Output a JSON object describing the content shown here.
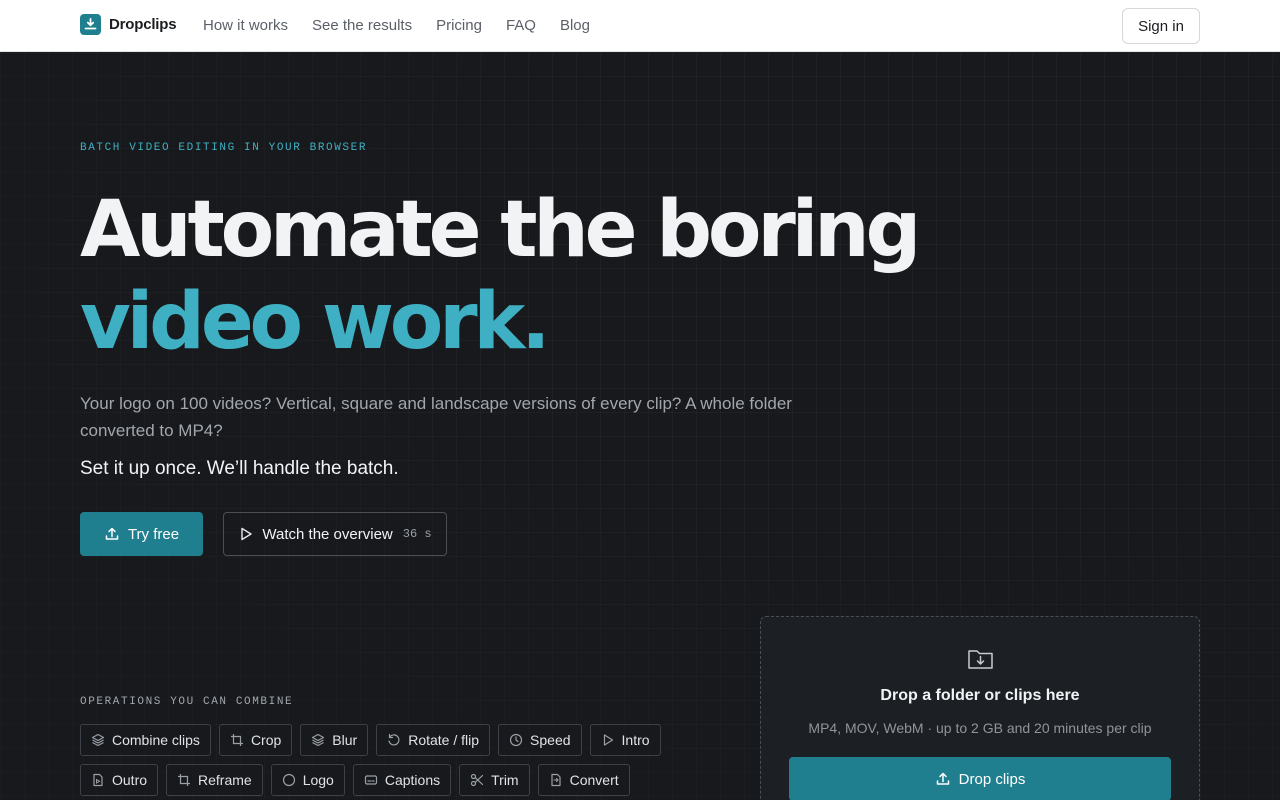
{
  "brand": {
    "name": "Dropclips",
    "accent": "#1f7f8f",
    "icon": "download-tray-icon"
  },
  "nav": {
    "links": [
      "How it works",
      "See the results",
      "Pricing",
      "FAQ",
      "Blog"
    ],
    "signin_label": "Sign in"
  },
  "hero": {
    "eyebrow": "BATCH VIDEO EDITING IN YOUR BROWSER",
    "headline_line1": "Automate the boring",
    "headline_line2": "video work.",
    "subtext": "Your logo on 100 videos? Vertical, square and landscape versions of every clip? A whole folder converted to MP4?",
    "tagline": "Set it up once. We’ll handle the batch.",
    "primary_cta": "Try free",
    "secondary_cta": "Watch the overview",
    "secondary_duration": "36 s",
    "highlight_color": "#3fb0c3"
  },
  "operations": {
    "label": "OPERATIONS YOU CAN COMBINE",
    "items": [
      {
        "label": "Combine clips",
        "icon": "layers-icon"
      },
      {
        "label": "Crop",
        "icon": "crop-icon"
      },
      {
        "label": "Blur",
        "icon": "layers-icon"
      },
      {
        "label": "Rotate / flip",
        "icon": "rotate-icon"
      },
      {
        "label": "Speed",
        "icon": "clock-icon"
      },
      {
        "label": "Intro",
        "icon": "play-icon"
      },
      {
        "label": "Outro",
        "icon": "file-icon"
      },
      {
        "label": "Reframe",
        "icon": "crop-icon"
      },
      {
        "label": "Logo",
        "icon": "circle-icon"
      },
      {
        "label": "Captions",
        "icon": "captions-icon"
      },
      {
        "label": "Trim",
        "icon": "scissors-icon"
      },
      {
        "label": "Convert",
        "icon": "file-convert-icon"
      }
    ]
  },
  "dropzone": {
    "title": "Drop a folder or clips here",
    "meta": "MP4, MOV, WebM · up to 2 GB and 20 minutes per clip",
    "button": "Drop clips",
    "icon": "folder-download-icon"
  }
}
